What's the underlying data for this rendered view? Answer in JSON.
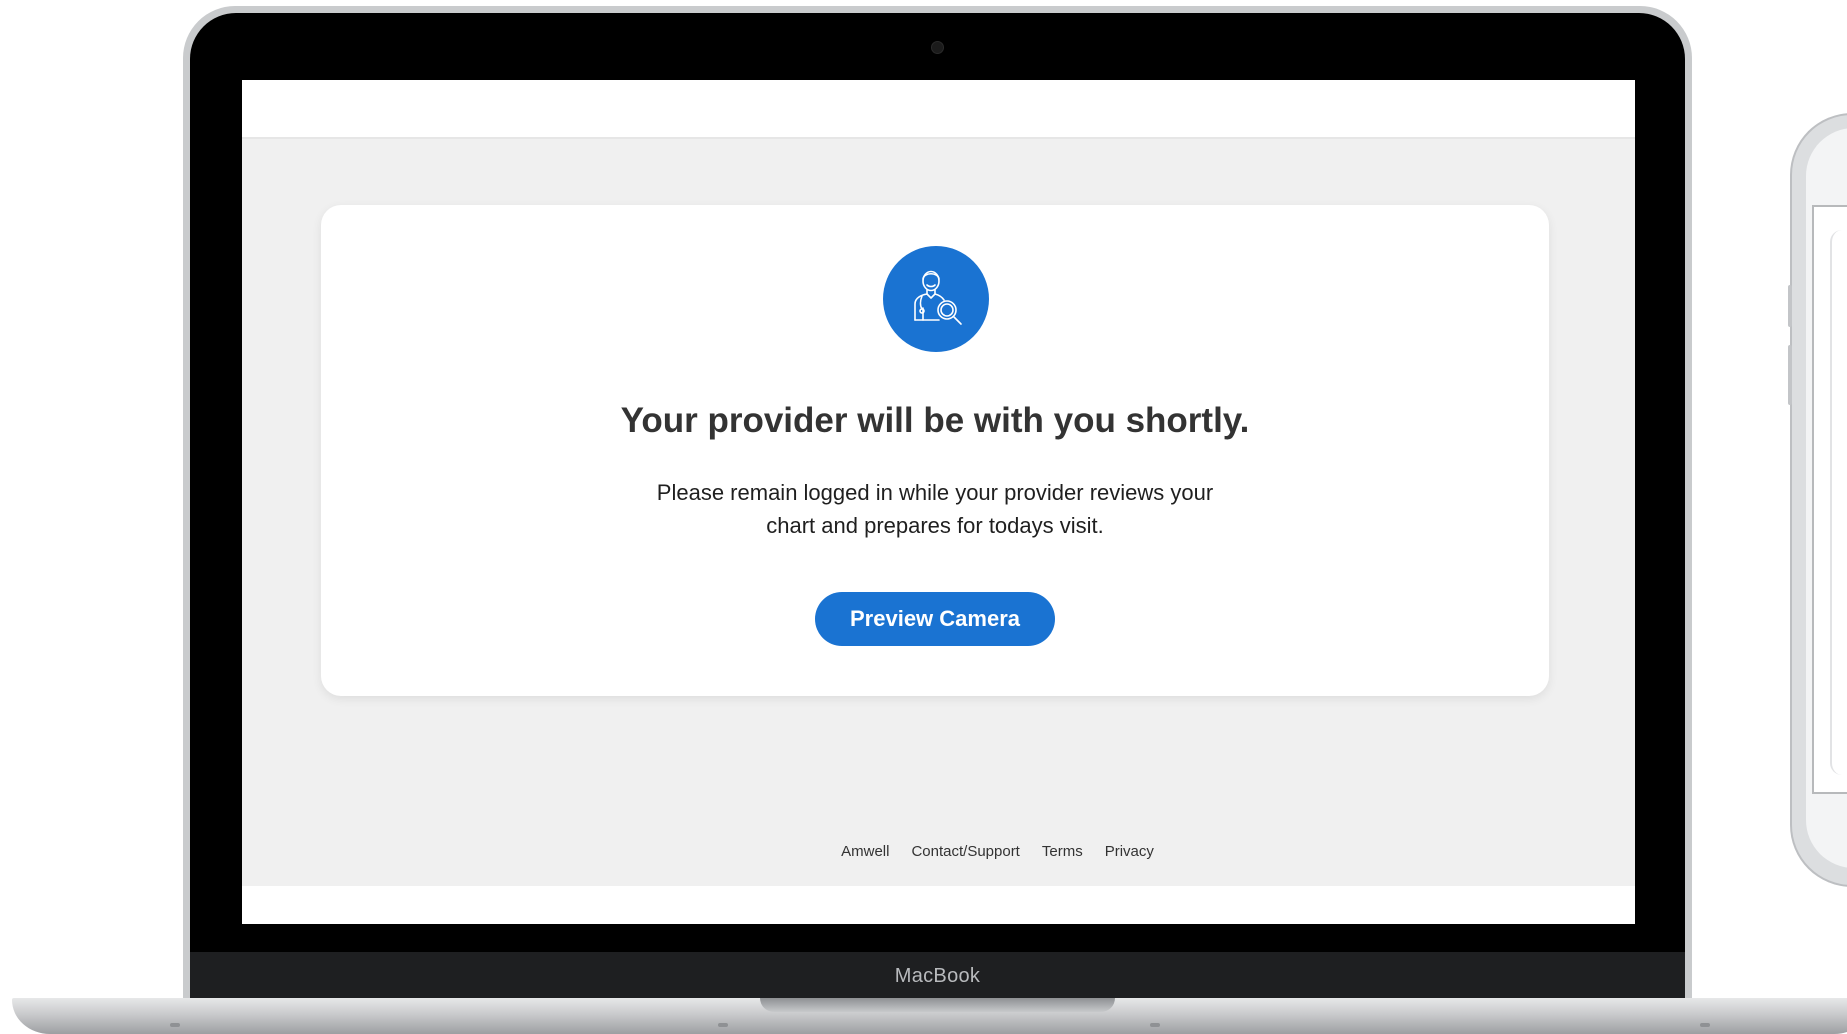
{
  "device": {
    "brand_label": "MacBook"
  },
  "waiting_card": {
    "icon": "doctor-with-magnifier-icon",
    "heading": "Your provider will be with you shortly.",
    "message_line1": "Please remain logged in while your provider reviews your",
    "message_line2": "chart and prepares for todays visit.",
    "button_label": "Preview Camera"
  },
  "footer": {
    "links": [
      "Amwell",
      "Contact/Support",
      "Terms",
      "Privacy"
    ]
  },
  "colors": {
    "brand_blue": "#1a73d2",
    "screen_background": "#f0f0f0",
    "card_background": "#ffffff",
    "heading_text": "#333333"
  }
}
